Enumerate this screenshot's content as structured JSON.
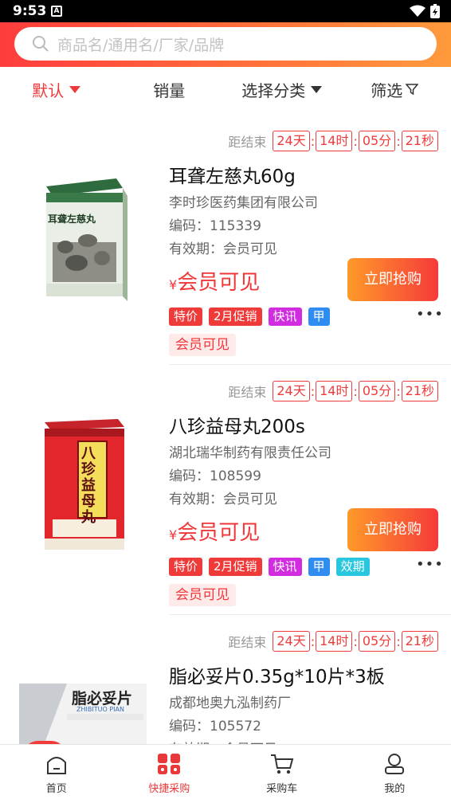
{
  "status_bar": {
    "time": "9:53"
  },
  "search": {
    "placeholder": "商品名/通用名/厂家/品牌"
  },
  "filters": [
    {
      "label": "默认",
      "active": true
    },
    {
      "label": "销量",
      "active": false
    },
    {
      "label": "选择分类",
      "active": false
    },
    {
      "label": "筛选",
      "active": false
    }
  ],
  "countdown_label": "距结束",
  "products": [
    {
      "name": "耳聋左慈丸60g",
      "manufacturer": "李时珍医药集团有限公司",
      "code": "编码：115339",
      "expiry": "有效期：会员可见",
      "price_symbol": "¥",
      "price": "会员可见",
      "buy_label": "立即抢购",
      "countdown": [
        "24天",
        "14时",
        "05分",
        "21秒"
      ],
      "tags": [
        {
          "text": "特价",
          "color": "#ef3a3a"
        },
        {
          "text": "2月促销",
          "color": "#ef3a3a"
        },
        {
          "text": "快讯",
          "color": "#d22ce0"
        },
        {
          "text": "甲",
          "color": "#2f8df1"
        }
      ],
      "member_badge": "会员可见",
      "box_text": "耳聋左慈丸"
    },
    {
      "name": "八珍益母丸200s",
      "manufacturer": "湖北瑞华制药有限责任公司",
      "code": "编码：108599",
      "expiry": "有效期：会员可见",
      "price_symbol": "¥",
      "price": "会员可见",
      "buy_label": "立即抢购",
      "countdown": [
        "24天",
        "14时",
        "05分",
        "21秒"
      ],
      "tags": [
        {
          "text": "特价",
          "color": "#ef3a3a"
        },
        {
          "text": "2月促销",
          "color": "#ef3a3a"
        },
        {
          "text": "快讯",
          "color": "#d22ce0"
        },
        {
          "text": "甲",
          "color": "#2f8df1"
        },
        {
          "text": "效期",
          "color": "#29c6e0"
        }
      ],
      "member_badge": "会员可见",
      "box_text": "八珍益母丸"
    },
    {
      "name": "脂必妥片0.35g*10片*3板",
      "manufacturer": "成都地奥九泓制药厂",
      "code": "编码：105572",
      "expiry": "有效期：会员可见",
      "countdown": [
        "24天",
        "14时",
        "05分",
        "21秒"
      ],
      "box_text": "脂必妥片",
      "box_subtext": "ZHIBITUO PIAN"
    }
  ],
  "bottom_nav": [
    {
      "label": "首页",
      "icon": "home-icon",
      "active": false
    },
    {
      "label": "快捷采购",
      "icon": "grid-icon",
      "active": true
    },
    {
      "label": "采购车",
      "icon": "cart-icon",
      "active": false
    },
    {
      "label": "我的",
      "icon": "user-icon",
      "active": false
    }
  ],
  "colors": {
    "accent": "#f0373a",
    "header_start": "#ff3c3c",
    "header_end": "#ff9a3c"
  }
}
